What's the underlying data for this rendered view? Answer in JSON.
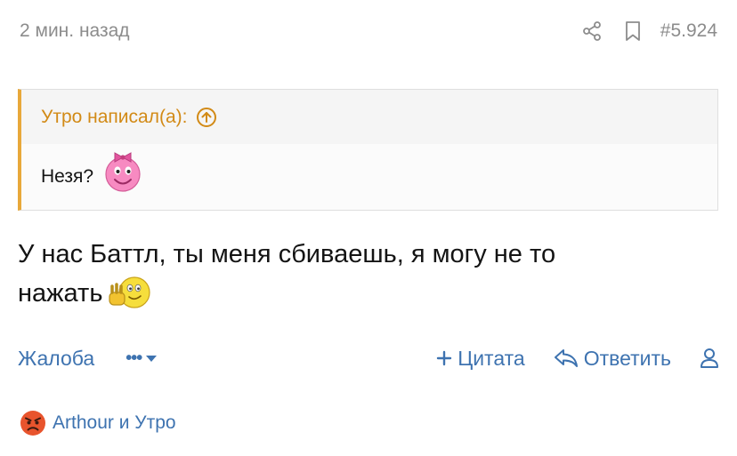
{
  "post": {
    "time": "2 мин. назад",
    "number": "#5.924",
    "share_icon": "share-icon",
    "bookmark_icon": "bookmark-icon"
  },
  "quote": {
    "author_text": "Утро написал(а):",
    "jump_icon": "arrow-up-circle-icon",
    "text": "Незя?",
    "smiley": "pink-bow-smiley",
    "accent_color": "#e8a83a"
  },
  "message": {
    "text_line1": "У нас Баттл, ты меня сбиваешь, я могу не то",
    "text_line2": "нажать",
    "smiley": "waving-smiley"
  },
  "actions": {
    "report": "Жалоба",
    "more": "•••",
    "quote": "Цитата",
    "reply": "Ответить",
    "link_color": "#3e73b0"
  },
  "reactions": {
    "emoji": "angry-face",
    "users": "Arthour и Утро"
  }
}
